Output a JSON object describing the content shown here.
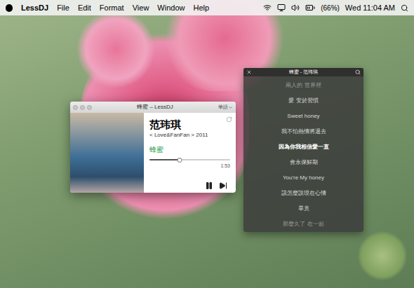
{
  "menu_bar": {
    "app": "LessDJ",
    "menus": [
      "File",
      "Edit",
      "Format",
      "View",
      "Window",
      "Help"
    ],
    "battery": "(66%)",
    "clock": "Wed 11:04 AM"
  },
  "player_window": {
    "title": "蜂蜜 – LessDJ",
    "channel": "華語",
    "artist": "范玮琪",
    "album_line": "< Love&FanFan > 2011",
    "song": "蜂蜜",
    "progress": {
      "level": 0.37,
      "time": "1:53"
    },
    "playing": true
  },
  "lyrics_window": {
    "title": "蜂蜜 - 范玮琪",
    "lines": [
      {
        "text": "兩人的 世界裡",
        "current": false,
        "dimmed": true
      },
      {
        "text": "愛 安於習慣",
        "current": false,
        "dimmed": false
      },
      {
        "text": "Sweet honey",
        "current": false,
        "dimmed": false
      },
      {
        "text": "我不怕熱情將退去",
        "current": false,
        "dimmed": false
      },
      {
        "text": "因為你我相信愛一直",
        "current": true,
        "dimmed": false
      },
      {
        "text": "會永保鮮期",
        "current": false,
        "dimmed": false
      },
      {
        "text": "You're My honey",
        "current": false,
        "dimmed": false
      },
      {
        "text": "該怎麼說現在心情",
        "current": false,
        "dimmed": false
      },
      {
        "text": "畢竟",
        "current": false,
        "dimmed": false
      },
      {
        "text": "那麼久了 在一起",
        "current": false,
        "dimmed": true
      }
    ]
  }
}
